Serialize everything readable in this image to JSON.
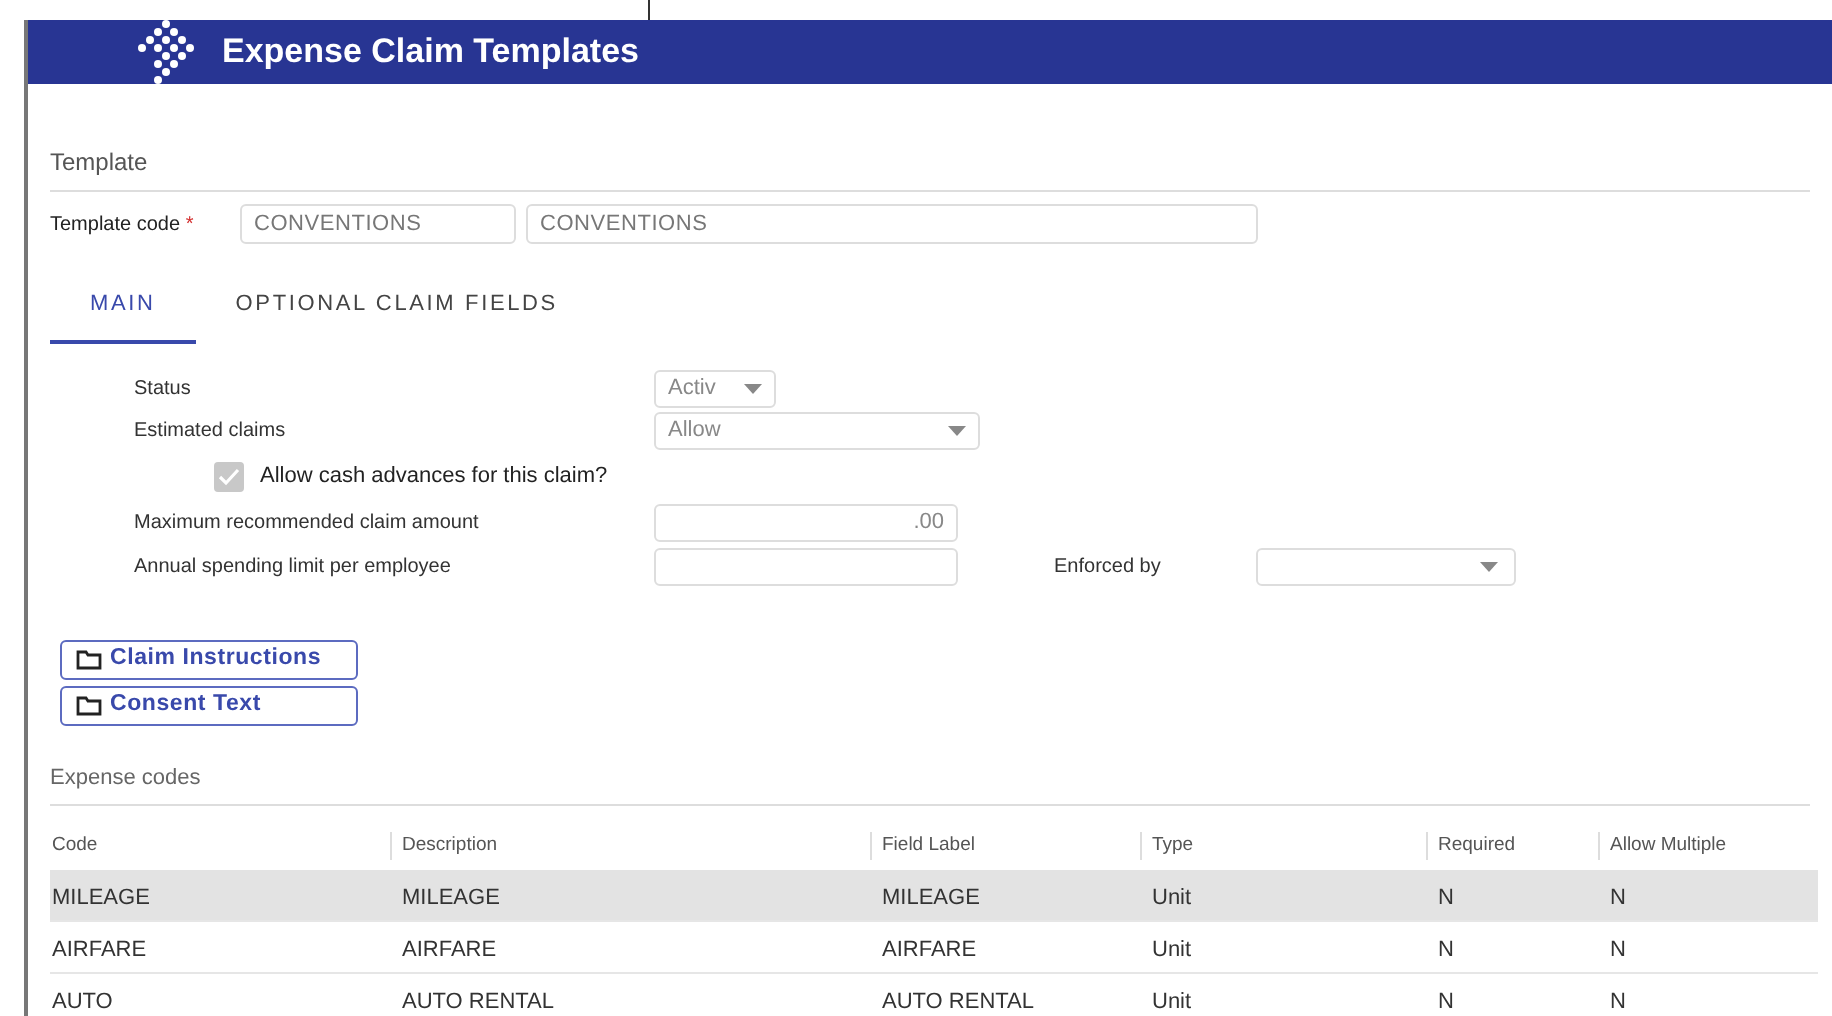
{
  "header": {
    "title": "Expense Claim Templates"
  },
  "template": {
    "section_title": "Template",
    "code_label": "Template code",
    "required_mark": "*",
    "code": "CONVENTIONS",
    "description": "CONVENTIONS"
  },
  "tabs": [
    {
      "label": "MAIN",
      "selected": true
    },
    {
      "label": "OPTIONAL CLAIM FIELDS",
      "selected": false
    }
  ],
  "main": {
    "status": {
      "label": "Status",
      "value": "Activ"
    },
    "estimated_claims": {
      "label": "Estimated claims",
      "value": "Allow"
    },
    "cash_advances": {
      "label": "Allow cash advances for this claim?",
      "checked": true,
      "disabled": true
    },
    "max_amount": {
      "label": "Maximum recommended claim amount",
      "value": ".00"
    },
    "annual_limit": {
      "label": "Annual spending limit per employee"
    },
    "enforced_by": {
      "label": "Enforced by"
    }
  },
  "folder_buttons": [
    "Claim Instructions",
    "Consent Text"
  ],
  "expense_codes": {
    "section_title": "Expense codes",
    "columns": [
      "Code",
      "Description",
      "Field Label",
      "Type",
      "Required",
      "Allow Multiple"
    ],
    "rows": [
      {
        "cells": [
          "MILEAGE",
          "MILEAGE",
          "MILEAGE",
          "Unit",
          "N",
          "N"
        ],
        "selected": true
      },
      {
        "cells": [
          "AIRFARE",
          "AIRFARE",
          "AIRFARE",
          "Unit",
          "N",
          "N"
        ],
        "selected": false
      },
      {
        "cells": [
          "AUTO",
          "AUTO RENTAL",
          "AUTO RENTAL",
          "Unit",
          "N",
          "N"
        ],
        "selected": false
      }
    ]
  }
}
